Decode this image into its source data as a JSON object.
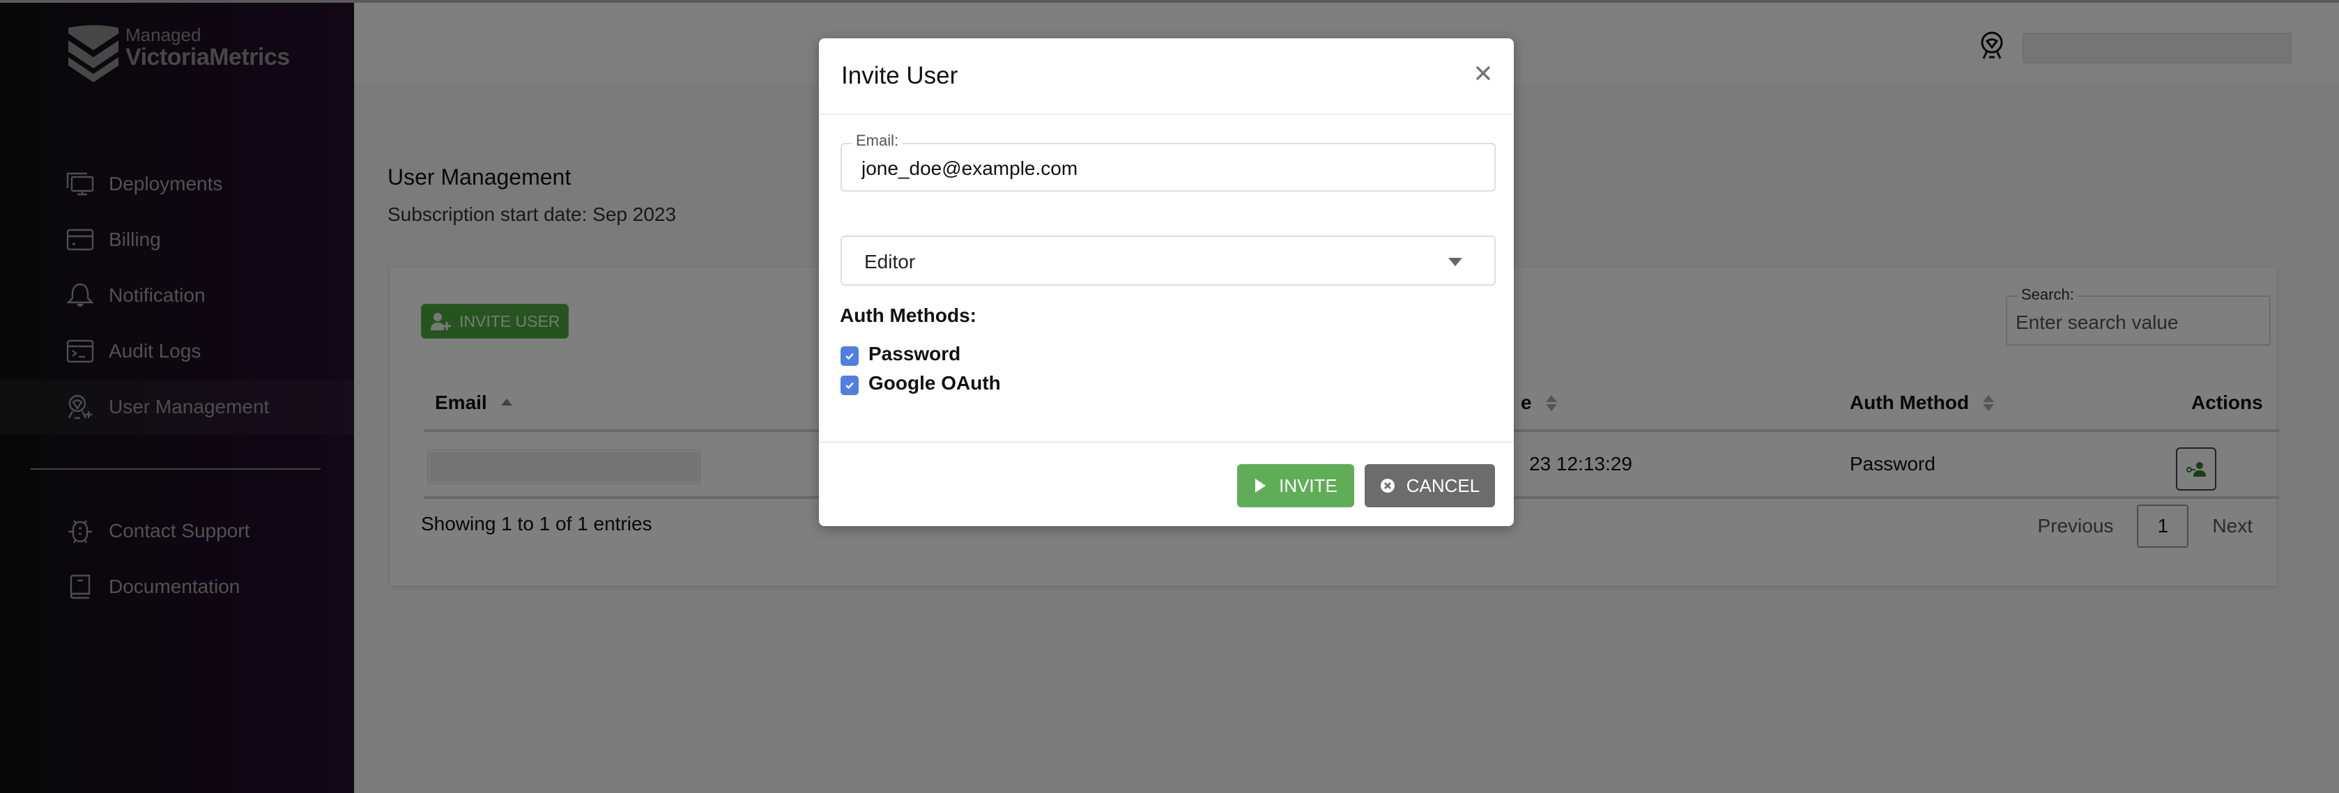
{
  "brand": {
    "small": "Managed",
    "big": "VictoriaMetrics",
    "logo_icon": "victoriametrics-chevron-logo"
  },
  "sidebar": {
    "items": [
      {
        "label": "Deployments",
        "icon": "monitor-icon",
        "active": false
      },
      {
        "label": "Billing",
        "icon": "credit-card-icon",
        "active": false
      },
      {
        "label": "Notification",
        "icon": "bell-icon",
        "active": false
      },
      {
        "label": "Audit Logs",
        "icon": "terminal-icon",
        "active": false
      },
      {
        "label": "User Management",
        "icon": "user-plus-icon",
        "active": true
      }
    ],
    "secondary": [
      {
        "label": "Contact Support",
        "icon": "bug-icon"
      },
      {
        "label": "Documentation",
        "icon": "book-icon"
      }
    ]
  },
  "header": {
    "profile_icon": "award-badge-icon",
    "profile_name": ""
  },
  "page": {
    "title": "User Management",
    "subtitle": "Subscription start date: Sep 2023"
  },
  "toolbar": {
    "invite_user_label": "INVITE USER"
  },
  "search": {
    "label": "Search:",
    "placeholder": "Enter search value",
    "value": ""
  },
  "table": {
    "columns": [
      {
        "label": "Email",
        "sort": "asc"
      },
      {
        "label": "e",
        "sort": "none"
      },
      {
        "label": "Auth Method",
        "sort": "none"
      },
      {
        "label": "Actions",
        "sort": null
      }
    ],
    "rows": [
      {
        "email": "",
        "date_partial": "23 12:13:29",
        "auth_method": "Password",
        "action_icon": "user-key-icon"
      }
    ],
    "showing": "Showing 1 to 1 of 1 entries"
  },
  "pagination": {
    "previous": "Previous",
    "current": "1",
    "next": "Next"
  },
  "modal": {
    "title": "Invite User",
    "email_label": "Email:",
    "email_value": "jone_doe@example.com",
    "role_value": "Editor",
    "auth_methods_label": "Auth Methods:",
    "auth_methods": [
      {
        "label": "Password",
        "checked": true
      },
      {
        "label": "Google OAuth",
        "checked": true
      }
    ],
    "invite_label": "INVITE",
    "cancel_label": "CANCEL"
  },
  "colors": {
    "invite_green": "#5fae57",
    "cancel_gray": "#6c6c6c",
    "checkbox_blue": "#4f7fe0",
    "sidebar_dark": "#111111",
    "sidebar_purple": "#230e2c"
  }
}
